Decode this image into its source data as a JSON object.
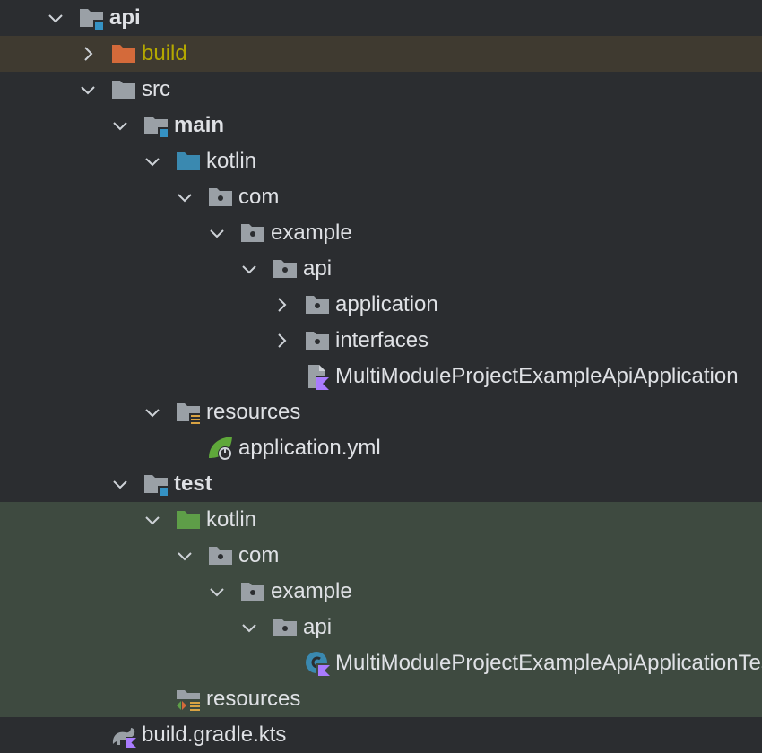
{
  "tree": {
    "rows": [
      {
        "label": "api",
        "expanded": true,
        "icon": "module-folder-icon",
        "bold": true
      },
      {
        "label": "build",
        "expanded": false,
        "icon": "excluded-folder-icon",
        "excluded": true
      },
      {
        "label": "src",
        "expanded": true,
        "icon": "folder-icon"
      },
      {
        "label": "main",
        "expanded": true,
        "icon": "module-folder-icon",
        "bold": true
      },
      {
        "label": "kotlin",
        "expanded": true,
        "icon": "source-root-folder-icon"
      },
      {
        "label": "com",
        "expanded": true,
        "icon": "package-icon"
      },
      {
        "label": "example",
        "expanded": true,
        "icon": "package-icon"
      },
      {
        "label": "api",
        "expanded": true,
        "icon": "package-icon"
      },
      {
        "label": "application",
        "expanded": false,
        "icon": "package-icon"
      },
      {
        "label": "interfaces",
        "expanded": false,
        "icon": "package-icon"
      },
      {
        "label": "MultiModuleProjectExampleApiApplication",
        "icon": "kotlin-file-icon"
      },
      {
        "label": "resources",
        "expanded": true,
        "icon": "resources-folder-icon"
      },
      {
        "label": "application.yml",
        "icon": "spring-config-icon"
      },
      {
        "label": "test",
        "expanded": true,
        "icon": "module-folder-icon",
        "bold": true
      },
      {
        "label": "kotlin",
        "expanded": true,
        "icon": "test-source-folder-icon",
        "test": true
      },
      {
        "label": "com",
        "expanded": true,
        "icon": "package-icon",
        "test": true
      },
      {
        "label": "example",
        "expanded": true,
        "icon": "package-icon",
        "test": true
      },
      {
        "label": "api",
        "expanded": true,
        "icon": "package-icon",
        "test": true
      },
      {
        "label": "MultiModuleProjectExampleApiApplicationTests",
        "icon": "kotlin-class-icon",
        "test": true
      },
      {
        "label": "resources",
        "icon": "test-resources-folder-icon",
        "test": true
      },
      {
        "label": "build.gradle.kts",
        "icon": "gradle-icon"
      }
    ]
  },
  "colors": {
    "background": "#2b2d30",
    "excluded_row": "#3f3a30",
    "test_row": "#3e4a40",
    "excluded_text": "#b4a800",
    "folder_gray": "#9aa0a6",
    "module_badge": "#3592c4",
    "kotlin_source": "#3a89b0",
    "test_source": "#5e9e48",
    "excluded_folder": "#d46a3a"
  }
}
